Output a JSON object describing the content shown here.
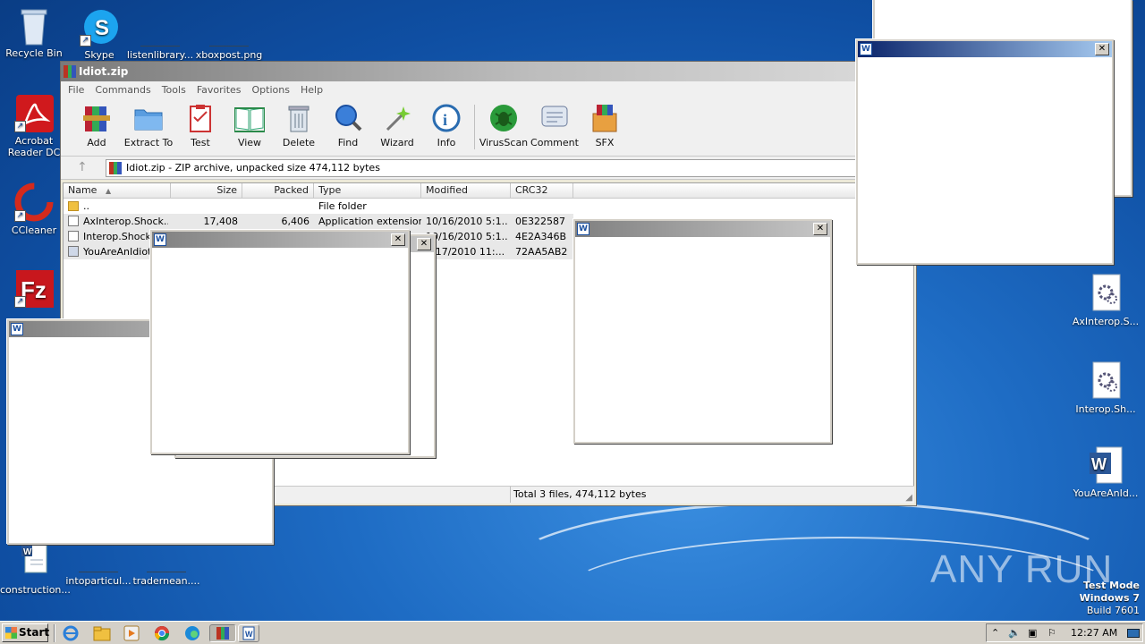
{
  "desktop": {
    "left_icons": [
      {
        "label": "Recycle Bin"
      },
      {
        "label": "Skype"
      },
      {
        "label": "listenlibrary..."
      },
      {
        "label": "xboxpost.png"
      },
      {
        "label": "Acrobat Reader DC"
      },
      {
        "label": "CCleaner"
      },
      {
        "label": "FileZilla Client"
      },
      {
        "label": "construction..."
      },
      {
        "label": "intoparticul..."
      },
      {
        "label": "tradernean...."
      }
    ],
    "right_icons": [
      {
        "label": "AxInterop.S..."
      },
      {
        "label": "Interop.Sh..."
      },
      {
        "label": "YouAreAnId..."
      }
    ],
    "watermark": "ANY RUN",
    "test_mode": {
      "line1": "Test Mode",
      "line2": "Windows 7",
      "line3": "Build 7601"
    }
  },
  "winrar": {
    "title": "Idiot.zip",
    "menu": [
      "File",
      "Commands",
      "Tools",
      "Favorites",
      "Options",
      "Help"
    ],
    "toolbar": [
      "Add",
      "Extract To",
      "Test",
      "View",
      "Delete",
      "Find",
      "Wizard",
      "Info",
      "VirusScan",
      "Comment",
      "SFX"
    ],
    "address": "Idiot.zip - ZIP archive, unpacked size 474,112 bytes",
    "columns": [
      "Name",
      "Size",
      "Packed",
      "Type",
      "Modified",
      "CRC32"
    ],
    "rows": [
      {
        "name": "..",
        "size": "",
        "packed": "",
        "type": "File folder",
        "modified": "",
        "crc": ""
      },
      {
        "name": "AxInterop.Shock...",
        "size": "17,408",
        "packed": "6,406",
        "type": "Application extension",
        "modified": "10/16/2010 5:1...",
        "crc": "0E322587"
      },
      {
        "name": "Interop.Shockw...",
        "size": "",
        "packed": "",
        "type": "",
        "modified": "10/16/2010 5:1...",
        "crc": "4E2A346B"
      },
      {
        "name": "YouAreAnIdiot...",
        "size": "",
        "packed": "",
        "type": "",
        "modified": "4/17/2010 11:...",
        "crc": "72AA5AB2"
      }
    ],
    "status": "Total 3 files, 474,112 bytes"
  },
  "popups": {
    "close_glyph": "✕"
  },
  "taskbar": {
    "start": "Start",
    "clock": "12:27 AM"
  }
}
